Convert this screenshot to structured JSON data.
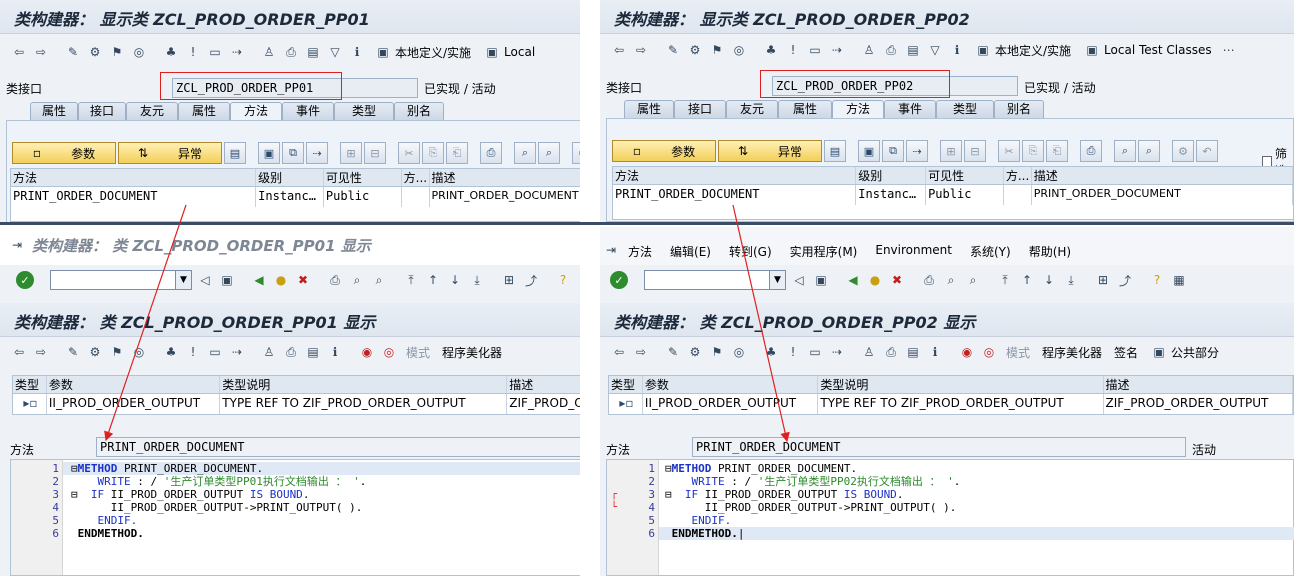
{
  "tl": {
    "title": "类构建器： 显示类 ZCL_PROD_ORDER_PP01",
    "toolbar_local_def": "本地定义/实施",
    "toolbar_local": "Local",
    "label_class": "类接口",
    "class_name": "ZCL_PROD_ORDER_PP01",
    "status": "已实现 / 活动",
    "tabs": [
      "属性",
      "接口",
      "友元",
      "属性",
      "方法",
      "事件",
      "类型",
      "别名"
    ],
    "param_btn": "参数",
    "exc_btn": "异常",
    "grid_headers": [
      "方法",
      "级别",
      "可见性",
      "方...",
      "描述"
    ],
    "grid_row": [
      "PRINT_ORDER_DOCUMENT",
      "Instanc…",
      "Public",
      "",
      "PRINT_ORDER_DOCUMENT"
    ]
  },
  "tr": {
    "title": "类构建器： 显示类 ZCL_PROD_ORDER_PP02",
    "toolbar_local_def": "本地定义/实施",
    "toolbar_local": "Local Test Classes",
    "label_class": "类接口",
    "class_name": "ZCL_PROD_ORDER_PP02",
    "status": "已实现 / 活动",
    "tabs": [
      "属性",
      "接口",
      "友元",
      "属性",
      "方法",
      "事件",
      "类型",
      "别名"
    ],
    "param_btn": "参数",
    "exc_btn": "异常",
    "filter_label": "筛选",
    "grid_headers": [
      "方法",
      "级别",
      "可见性",
      "方...",
      "描述"
    ],
    "grid_row": [
      "PRINT_ORDER_DOCUMENT",
      "Instanc…",
      "Public",
      "",
      "PRINT_ORDER_DOCUMENT"
    ]
  },
  "bl": {
    "window_title": "类构建器： 类 ZCL_PROD_ORDER_PP01 显示",
    "title": "类构建器： 类 ZCL_PROD_ORDER_PP01 显示",
    "toolbar_pattern": "模式",
    "toolbar_pretty": "程序美化器",
    "param_headers": [
      "类型",
      "参数",
      "类型说明",
      "描述"
    ],
    "param_row": [
      "II_PROD_ORDER_OUTPUT",
      "TYPE REF TO ZIF_PROD_ORDER_OUTPUT",
      "ZIF_PROD_O"
    ],
    "method_label": "方法",
    "method_name": "PRINT_ORDER_DOCUMENT",
    "line_numbers": "1\n2\n3\n4\n5\n6",
    "code": {
      "l1a": "METHOD",
      "l1b": " PRINT_ORDER_DOCUMENT.",
      "l2a": "  WRITE",
      "l2b": " : / ",
      "l2c": "'生产订单类型PP01执行文档输出 ： '",
      "l2d": ".",
      "l3a": "  IF",
      "l3b": " II_PROD_ORDER_OUTPUT ",
      "l3c": "IS BOUND",
      "l3d": ".",
      "l4": "    II_PROD_ORDER_OUTPUT->PRINT_OUTPUT( ).",
      "l5": "  ENDIF.",
      "l6": "ENDMETHOD."
    }
  },
  "br": {
    "menu": [
      "方法",
      "编辑(E)",
      "转到(G)",
      "实用程序(M)",
      "Environment",
      "系统(Y)",
      "帮助(H)"
    ],
    "title": "类构建器： 类 ZCL_PROD_ORDER_PP02 显示",
    "toolbar_pattern": "模式",
    "toolbar_pretty": "程序美化器",
    "toolbar_sign": "签名",
    "toolbar_public": "公共部分",
    "param_headers": [
      "类型",
      "参数",
      "类型说明",
      "描述"
    ],
    "param_row": [
      "II_PROD_ORDER_OUTPUT",
      "TYPE REF TO ZIF_PROD_ORDER_OUTPUT",
      "ZIF_PROD_ORDER_OUTPUT"
    ],
    "method_label": "方法",
    "method_name": "PRINT_ORDER_DOCUMENT",
    "method_status": "活动",
    "line_numbers": "1\n2\n3\n4\n5\n6",
    "code": {
      "l1a": "METHOD",
      "l1b": " PRINT_ORDER_DOCUMENT.",
      "l2a": "  WRITE",
      "l2b": " : / ",
      "l2c": "'生产订单类型PP02执行文档输出 ： '",
      "l2d": ".",
      "l3a": "  IF",
      "l3b": " II_PROD_ORDER_OUTPUT ",
      "l3c": "IS BOUND",
      "l3d": ".",
      "l4": "    II_PROD_ORDER_OUTPUT->PRINT_OUTPUT( ).",
      "l5": "  ENDIF.",
      "l6": "ENDMETHOD."
    }
  },
  "colors": {
    "annotation_red": "#e02020",
    "sap_blue": "#1a32c8"
  }
}
